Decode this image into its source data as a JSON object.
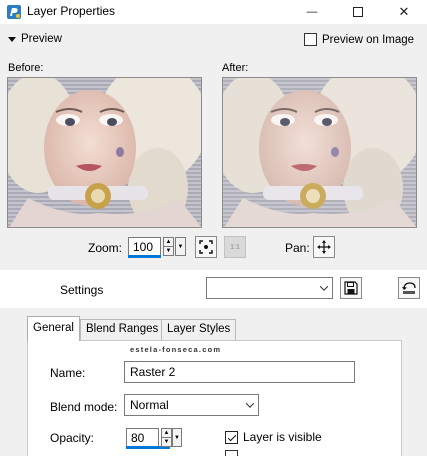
{
  "window": {
    "title": "Layer Properties",
    "minimize_glyph": "—",
    "maximize_glyph": "☐",
    "close_glyph": "✕"
  },
  "preview": {
    "toggle_label": "Preview",
    "preview_on_image_label": "Preview on Image",
    "preview_on_image_checked": false,
    "before_label": "Before:",
    "after_label": "After:"
  },
  "zoom": {
    "label": "Zoom:",
    "value": "100",
    "pan_label": "Pan:"
  },
  "settings": {
    "label": "Settings",
    "preset_value": ""
  },
  "tabs": [
    {
      "label": "General",
      "active": true
    },
    {
      "label": "Blend Ranges",
      "active": false
    },
    {
      "label": "Layer Styles",
      "active": false
    }
  ],
  "watermark": "estela-fonseca.com",
  "general": {
    "name_label": "Name:",
    "name_value": "Raster 2",
    "blend_mode_label": "Blend mode:",
    "blend_mode_value": "Normal",
    "opacity_label": "Opacity:",
    "opacity_value": "80",
    "layer_visible_label": "Layer is visible",
    "layer_visible_checked": true
  },
  "colors": {
    "accent": "#0078d7"
  }
}
